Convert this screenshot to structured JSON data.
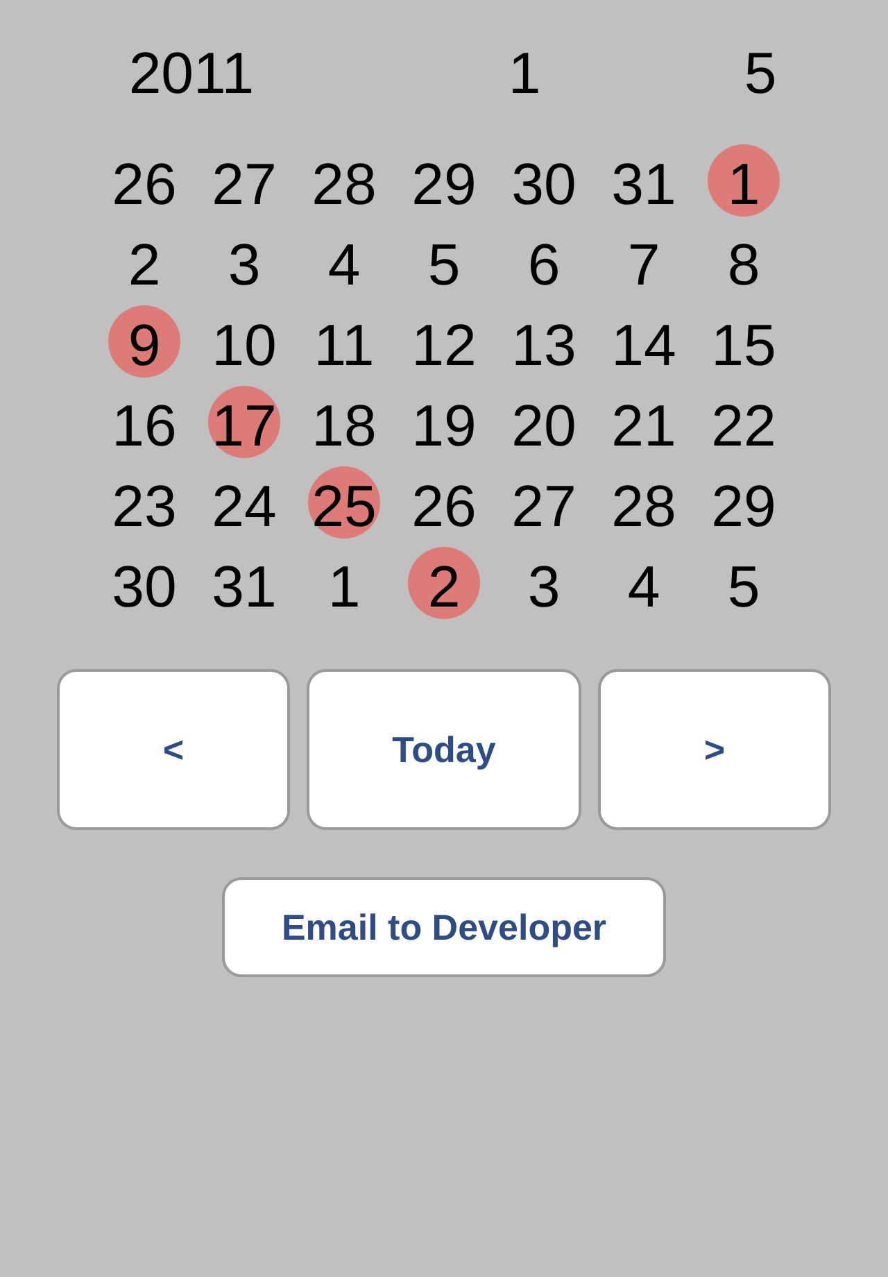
{
  "header": {
    "year": "2011",
    "column_2": "1",
    "column_3": "5"
  },
  "weeks": [
    [
      {
        "day": "26",
        "marked": false
      },
      {
        "day": "27",
        "marked": false
      },
      {
        "day": "28",
        "marked": false
      },
      {
        "day": "29",
        "marked": false
      },
      {
        "day": "30",
        "marked": false
      },
      {
        "day": "31",
        "marked": false
      },
      {
        "day": "1",
        "marked": true
      }
    ],
    [
      {
        "day": "2",
        "marked": false
      },
      {
        "day": "3",
        "marked": false
      },
      {
        "day": "4",
        "marked": false
      },
      {
        "day": "5",
        "marked": false
      },
      {
        "day": "6",
        "marked": false
      },
      {
        "day": "7",
        "marked": false
      },
      {
        "day": "8",
        "marked": false
      }
    ],
    [
      {
        "day": "9",
        "marked": true
      },
      {
        "day": "10",
        "marked": false
      },
      {
        "day": "11",
        "marked": false
      },
      {
        "day": "12",
        "marked": false
      },
      {
        "day": "13",
        "marked": false
      },
      {
        "day": "14",
        "marked": false
      },
      {
        "day": "15",
        "marked": false
      }
    ],
    [
      {
        "day": "16",
        "marked": false
      },
      {
        "day": "17",
        "marked": true
      },
      {
        "day": "18",
        "marked": false
      },
      {
        "day": "19",
        "marked": false
      },
      {
        "day": "20",
        "marked": false
      },
      {
        "day": "21",
        "marked": false
      },
      {
        "day": "22",
        "marked": false
      }
    ],
    [
      {
        "day": "23",
        "marked": false
      },
      {
        "day": "24",
        "marked": false
      },
      {
        "day": "25",
        "marked": true
      },
      {
        "day": "26",
        "marked": false
      },
      {
        "day": "27",
        "marked": false
      },
      {
        "day": "28",
        "marked": false
      },
      {
        "day": "29",
        "marked": false
      }
    ],
    [
      {
        "day": "30",
        "marked": false
      },
      {
        "day": "31",
        "marked": false
      },
      {
        "day": "1",
        "marked": false
      },
      {
        "day": "2",
        "marked": true
      },
      {
        "day": "3",
        "marked": false
      },
      {
        "day": "4",
        "marked": false
      },
      {
        "day": "5",
        "marked": false
      }
    ]
  ],
  "nav_buttons": [
    "<",
    "Today",
    ">"
  ],
  "email_button": "Email to Developer"
}
